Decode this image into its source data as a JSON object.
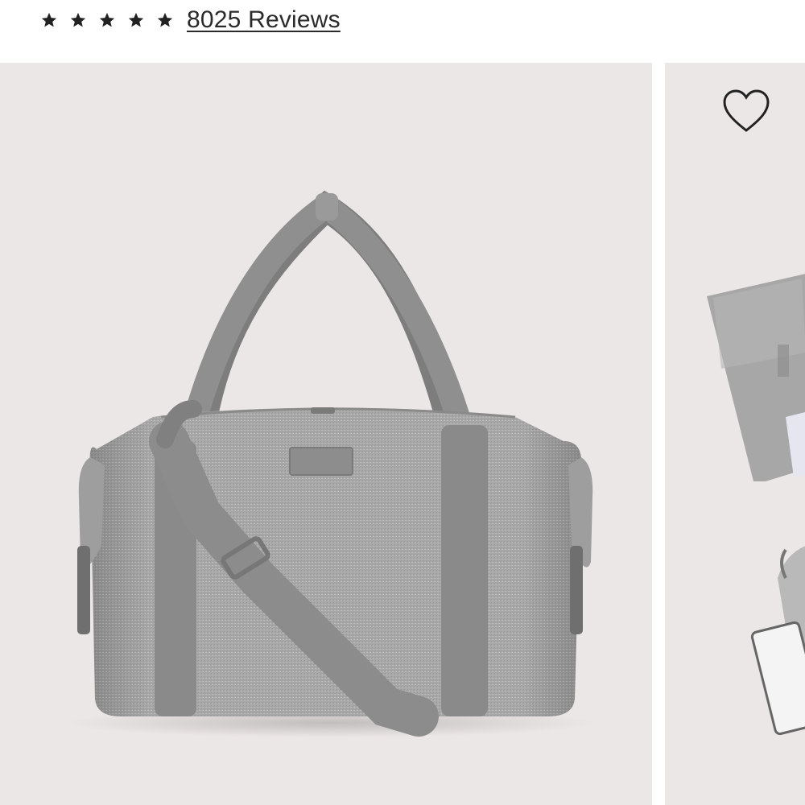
{
  "rating": {
    "stars_filled": 5,
    "stars_total": 5,
    "reviews_label": "8025 Reviews"
  },
  "gallery": {
    "main_image_icon": "duffel-bag-image",
    "next_image_icon": "bag-contents-image",
    "favorite_icon": "heart-outline-icon"
  },
  "colors": {
    "gallery_bg": "#ece7e7",
    "bag_heather": "#a9a9a9",
    "strap": "#8e8e8e",
    "text": "#2a2a2a"
  }
}
